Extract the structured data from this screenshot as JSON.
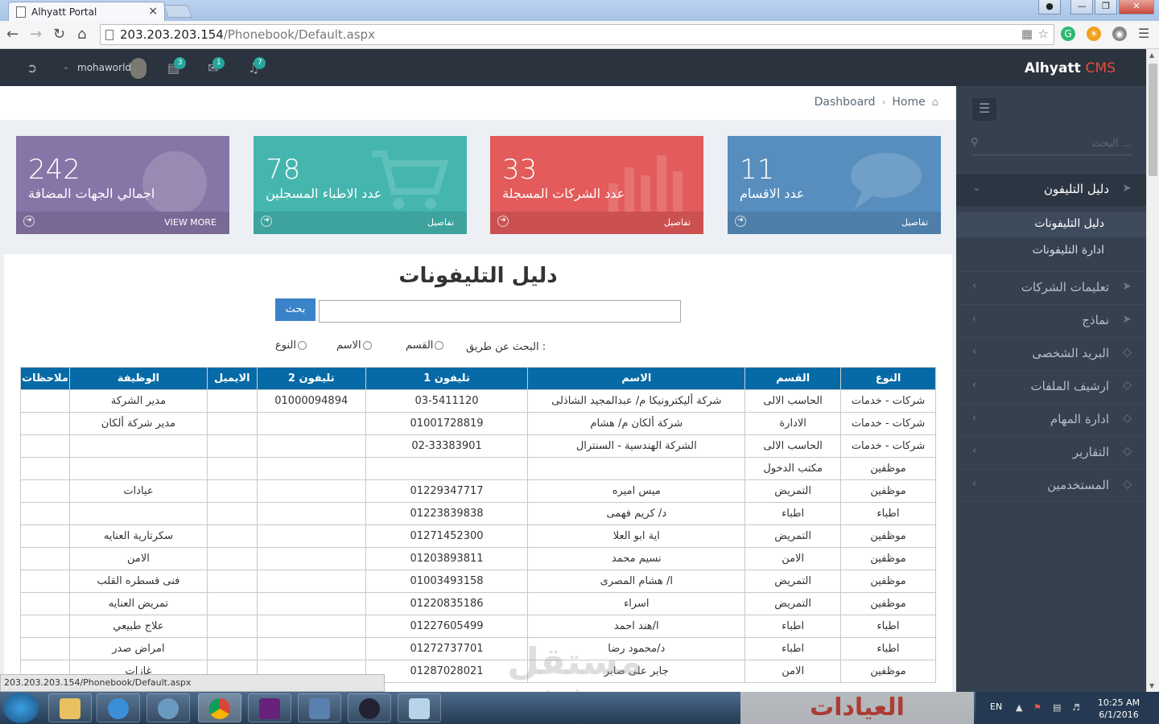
{
  "browser": {
    "tab_title": "Alhyatt Portal",
    "tab_close": "×",
    "url_host": "203.203.203.154",
    "url_path": "/Phonebook/Default.aspx",
    "status_url": "203.203.203.154/Phonebook/Default.aspx"
  },
  "header": {
    "brand": "Alhyatt",
    "brand_suffix": "CMS",
    "username": "mohaworld",
    "badges": {
      "tasks": "3",
      "messages": "1",
      "notifications": "7"
    }
  },
  "breadcrumb": {
    "home": "Home",
    "dashboard": "Dashboard"
  },
  "stats": [
    {
      "number": "11",
      "label": "عدد الاقسام",
      "link": "تفاصيل",
      "color": "#578ebe"
    },
    {
      "number": "33",
      "label": "عدد الشركات المسجلة",
      "link": "تفاصيل",
      "color": "#e35b5a"
    },
    {
      "number": "78",
      "label": "عدد الاطباء المسجلين",
      "link": "تفاصيل",
      "color": "#44b6ae"
    },
    {
      "number": "242",
      "label": "اجمالي الجهات المضافة",
      "link": "VIEW MORE",
      "color": "#8775a7"
    }
  ],
  "sidebar": {
    "search_placeholder": "البحث ...",
    "items": [
      {
        "label": "دليل التليفون",
        "icon": "rocket-icon"
      },
      {
        "label": "تعليمات الشركات",
        "icon": "rocket-icon"
      },
      {
        "label": "نماذج",
        "icon": "rocket-icon"
      },
      {
        "label": "البريد الشخصى",
        "icon": "diamond-icon"
      },
      {
        "label": "ارشيف الملفات",
        "icon": "diamond-icon"
      },
      {
        "label": "ادارة المهام",
        "icon": "diamond-icon"
      },
      {
        "label": "التقارير",
        "icon": "diamond-icon"
      },
      {
        "label": "المستخدمين",
        "icon": "diamond-icon"
      }
    ],
    "subitems": [
      "دليل التليفونات",
      "ادارة التليفونات"
    ]
  },
  "phonebook": {
    "title": "دليل التليفونات",
    "search_button": "بحث",
    "search_value": "",
    "search_by": "البحث عن طريق :",
    "options": [
      "القسم",
      "الاسم",
      "النوع"
    ],
    "columns": [
      "النوع",
      "القسم",
      "الاسم",
      "تليفون 1",
      "تليفون 2",
      "الايميل",
      "الوظيفة",
      "ملاحظات"
    ],
    "rows": [
      [
        "شركات - خدمات",
        "الحاسب الالى",
        "شركة أليكترونيكا م/ عبدالمجيد الشاذلى",
        "03-5411120",
        "01000094894",
        "",
        "مدير الشركة",
        ""
      ],
      [
        "شركات - خدمات",
        "الادارة",
        "شركة ألكان م/ هشام",
        "01001728819",
        "",
        "",
        "مدير شركة ألكان",
        ""
      ],
      [
        "شركات - خدمات",
        "الحاسب الالى",
        "الشركة الهندسية - السنترال",
        "02-33383901",
        "",
        "",
        "",
        ""
      ],
      [
        "موظفين",
        "مكتب الدخول",
        "",
        "",
        "",
        "",
        "",
        ""
      ],
      [
        "موظفين",
        "التمريض",
        "ميس اميره",
        "01229347717",
        "",
        "",
        "عيادات",
        ""
      ],
      [
        "اطباء",
        "اطباء",
        "د/ كريم فهمى",
        "01223839838",
        "",
        "",
        "",
        ""
      ],
      [
        "موظفين",
        "التمريض",
        "اية ابو العلا",
        "01271452300",
        "",
        "",
        "سكرتارية العنايه",
        ""
      ],
      [
        "موظفين",
        "الامن",
        "نسيم محمد",
        "01203893811",
        "",
        "",
        "الامن",
        ""
      ],
      [
        "موظفين",
        "التمريض",
        "ا/ هشام المصرى",
        "01003493158",
        "",
        "",
        "فنى قسطره القلب",
        ""
      ],
      [
        "موظفين",
        "التمريض",
        "اسراء",
        "01220835186",
        "",
        "",
        "تمريض العنايه",
        ""
      ],
      [
        "اطباء",
        "اطباء",
        "ا/هند احمد",
        "01227605499",
        "",
        "",
        "علاج طبيعي",
        ""
      ],
      [
        "اطباء",
        "اطباء",
        "د/محمود رضا",
        "01272737701",
        "",
        "",
        "امراض صدر",
        ""
      ],
      [
        "موظفين",
        "الامن",
        "جابر على صابر",
        "01287028021",
        "",
        "",
        "غازات",
        ""
      ]
    ]
  },
  "watermark": {
    "arabic": "مستقل",
    "latin": "mostaqi.com"
  },
  "taskbar": {
    "banner": "العيادات",
    "lang": "EN",
    "time": "10:25 AM",
    "date": "6/1/2016"
  }
}
